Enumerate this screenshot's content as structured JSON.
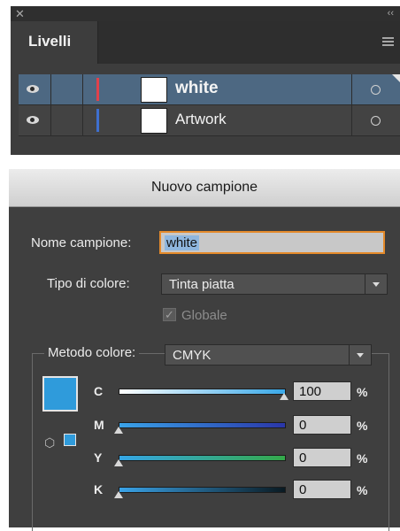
{
  "layers_panel": {
    "tab_label": "Livelli",
    "layers": [
      {
        "name": "white",
        "color": "#e0414b",
        "selected": true
      },
      {
        "name": "Artwork",
        "color": "#3e6fcf",
        "selected": false
      }
    ]
  },
  "dialog": {
    "title": "Nuovo campione",
    "name_label": "Nome campione:",
    "name_value": "white",
    "type_label": "Tipo di colore:",
    "type_value": "Tinta piatta",
    "global_label": "Globale",
    "global_checked": true,
    "mode_label": "Metodo colore:",
    "mode_value": "CMYK",
    "swatch_color": "#2f9bdb",
    "channels": [
      {
        "label": "C",
        "value": "100",
        "unit": "%",
        "fraction": 1.0
      },
      {
        "label": "M",
        "value": "0",
        "unit": "%",
        "fraction": 0.0
      },
      {
        "label": "Y",
        "value": "0",
        "unit": "%",
        "fraction": 0.0
      },
      {
        "label": "K",
        "value": "0",
        "unit": "%",
        "fraction": 0.0
      }
    ]
  },
  "icons": [
    "close-icon",
    "collapse-icon",
    "panel-menu-icon",
    "eye-icon",
    "out-of-gamut-cube-icon"
  ]
}
